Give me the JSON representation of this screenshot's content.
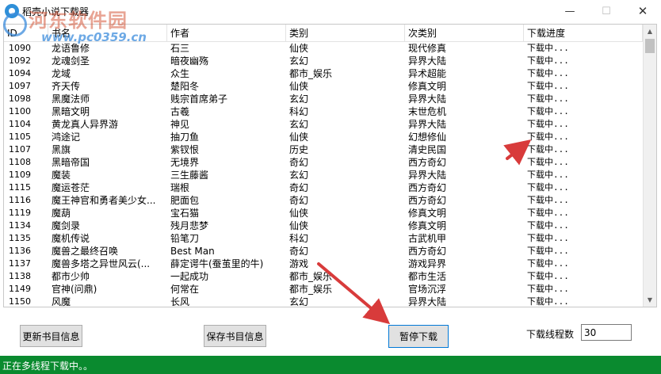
{
  "window": {
    "title": "稻壳小说下载器",
    "minimize_glyph": "—",
    "maximize_glyph": "☐",
    "close_glyph": "✕"
  },
  "watermark": {
    "main": "河东软件园",
    "sub": "www.pc0359.cn"
  },
  "table": {
    "columns": [
      "ID",
      "书名",
      "作者",
      "类别",
      "次类别",
      "下载进度"
    ],
    "rows": [
      {
        "id": "1090",
        "name": "龙语鲁修",
        "author": "石三",
        "category": "仙侠",
        "subcategory": "现代修真",
        "progress": "下载中..."
      },
      {
        "id": "1092",
        "name": "龙魂剑圣",
        "author": "暗夜幽殇",
        "category": "玄幻",
        "subcategory": "异界大陆",
        "progress": "下载中..."
      },
      {
        "id": "1094",
        "name": "龙域",
        "author": "众生",
        "category": "都市_娱乐",
        "subcategory": "异术超能",
        "progress": "下载中..."
      },
      {
        "id": "1097",
        "name": "齐天传",
        "author": "楚阳冬",
        "category": "仙侠",
        "subcategory": "修真文明",
        "progress": "下载中..."
      },
      {
        "id": "1098",
        "name": "黑魔法师",
        "author": "贱宗首席弟子",
        "category": "玄幻",
        "subcategory": "异界大陆",
        "progress": "下载中..."
      },
      {
        "id": "1100",
        "name": "黑暗文明",
        "author": "古羲",
        "category": "科幻",
        "subcategory": "末世危机",
        "progress": "下载中..."
      },
      {
        "id": "1104",
        "name": "黄龙真人异界游",
        "author": "神见",
        "category": "玄幻",
        "subcategory": "异界大陆",
        "progress": "下载中..."
      },
      {
        "id": "1105",
        "name": "鸿途记",
        "author": "抽刀鱼",
        "category": "仙侠",
        "subcategory": "幻想修仙",
        "progress": "下载中..."
      },
      {
        "id": "1107",
        "name": "黑旗",
        "author": "紫钗恨",
        "category": "历史",
        "subcategory": "清史民国",
        "progress": "下载中..."
      },
      {
        "id": "1108",
        "name": "黑暗帝国",
        "author": "无境界",
        "category": "奇幻",
        "subcategory": "西方奇幻",
        "progress": "下载中..."
      },
      {
        "id": "1109",
        "name": "魔装",
        "author": "三生藤酱",
        "category": "玄幻",
        "subcategory": "异界大陆",
        "progress": "下载中..."
      },
      {
        "id": "1115",
        "name": "魔运苍茫",
        "author": "瑞根",
        "category": "奇幻",
        "subcategory": "西方奇幻",
        "progress": "下载中..."
      },
      {
        "id": "1116",
        "name": "魔王神官和勇者美少女...",
        "author": "肥面包",
        "category": "奇幻",
        "subcategory": "西方奇幻",
        "progress": "下载中..."
      },
      {
        "id": "1119",
        "name": "魔葫",
        "author": "宝石猫",
        "category": "仙侠",
        "subcategory": "修真文明",
        "progress": "下载中..."
      },
      {
        "id": "1134",
        "name": "魔剑录",
        "author": "残月悲梦",
        "category": "仙侠",
        "subcategory": "修真文明",
        "progress": "下载中..."
      },
      {
        "id": "1135",
        "name": "魔机传说",
        "author": "铅笔刀",
        "category": "科幻",
        "subcategory": "古武机甲",
        "progress": "下载中..."
      },
      {
        "id": "1136",
        "name": "魔兽之最终召唤",
        "author": "Best Man",
        "category": "奇幻",
        "subcategory": "西方奇幻",
        "progress": "下载中..."
      },
      {
        "id": "1137",
        "name": "魔兽多塔之异世风云(...",
        "author": "薛定谔牛(蚕茧里的牛)",
        "category": "游戏",
        "subcategory": "游戏异界",
        "progress": "下载中..."
      },
      {
        "id": "1138",
        "name": "都市少帅",
        "author": "一起成功",
        "category": "都市_娱乐",
        "subcategory": "都市生活",
        "progress": "下载中..."
      },
      {
        "id": "1149",
        "name": "官神(问鼎)",
        "author": "何常在",
        "category": "都市_娱乐",
        "subcategory": "官场沉浮",
        "progress": "下载中..."
      },
      {
        "id": "1150",
        "name": "风魔",
        "author": "长风",
        "category": "玄幻",
        "subcategory": "异界大陆",
        "progress": "下载中..."
      }
    ]
  },
  "controls": {
    "update_button": "更新书目信息",
    "save_button": "保存书目信息",
    "pause_button": "暂停下载",
    "thread_label": "下载线程数",
    "thread_value": "30"
  },
  "status": {
    "text": "正在多线程下载中。。",
    "color": "#0a8a2f"
  },
  "annotation_color": "#d83b3b"
}
